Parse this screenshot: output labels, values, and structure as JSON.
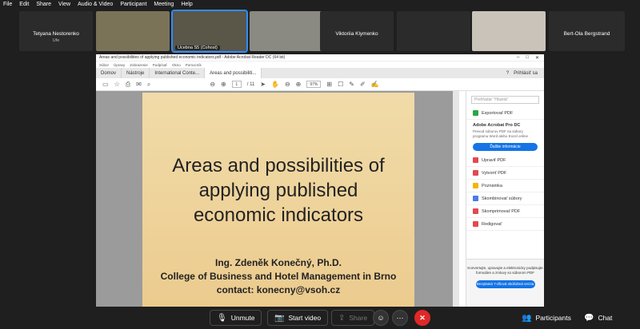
{
  "menubar": [
    "File",
    "Edit",
    "Share",
    "View",
    "Audio & Video",
    "Participant",
    "Meeting",
    "Help"
  ],
  "participants": [
    {
      "name": "Tetyana Nestorenko",
      "sub": "Ufe",
      "video": false
    },
    {
      "name": "",
      "sub": "",
      "video": true
    },
    {
      "name": "",
      "label": "Ucebna S5 (Cohost)",
      "video": true,
      "active": true
    },
    {
      "name": "",
      "sub": "",
      "video": true
    },
    {
      "name": "Viktoriia Klymenko",
      "sub": "",
      "video": false
    },
    {
      "name": "",
      "sub": "",
      "video": false
    },
    {
      "name": "",
      "sub": "",
      "video": true
    },
    {
      "name": "Bert-Ola Bergstrand",
      "sub": "",
      "video": false
    }
  ],
  "acrobat": {
    "window_title": "Areas and possibilities of applying published economic indicators.pdf - Adobe Acrobat Reader DC (64 bit)",
    "menu": [
      "Súbor",
      "Úpravy",
      "Zobrazenie",
      "Podpísať",
      "Okno",
      "Pomocník"
    ],
    "tabs": [
      "Domov",
      "Nástroje",
      "International Conte...",
      "Areas and possibiliti..."
    ],
    "signin": "Prihlásiť sa",
    "page_current": "1",
    "page_total": "/ 11",
    "zoom": "97%"
  },
  "slide": {
    "title_lines": [
      "Areas and possibilities of",
      "applying published",
      "economic indicators"
    ],
    "author": "Ing. Zdeněk Konečný, Ph.D.",
    "college": "College of Business and Hotel Management in Brno",
    "contact": "contact: konecny@vsoh.cz"
  },
  "panel": {
    "search": "Prehľadať \"Hlasitá\"",
    "export": "Exportovať PDF",
    "promo_title": "Adobe Acrobat Pro DC",
    "promo_text": "Prevod súborov PDF na súbory programu Word alebo Excel online",
    "promo_btn": "Ďalšie informácie",
    "items": [
      "Upraviť PDF",
      "Vytvoriť PDF",
      "Poznámka",
      "Skombinovať súbory",
      "Skomprimovať PDF",
      "Redigovať"
    ],
    "bottom_text": "Konvertujte, upravujte a elektronicky podpisujte formuláre a zmluvy so súborom PDF",
    "bottom_btn": "Bezplatná 7-dňová skúšobná verzia"
  },
  "controls": {
    "unmute": "Unmute",
    "start_video": "Start video",
    "share": "Share",
    "participants": "Participants",
    "chat": "Chat"
  },
  "colors": {
    "accent": "#2d8cff",
    "end": "#e02828",
    "adobe_blue": "#1473e6"
  }
}
